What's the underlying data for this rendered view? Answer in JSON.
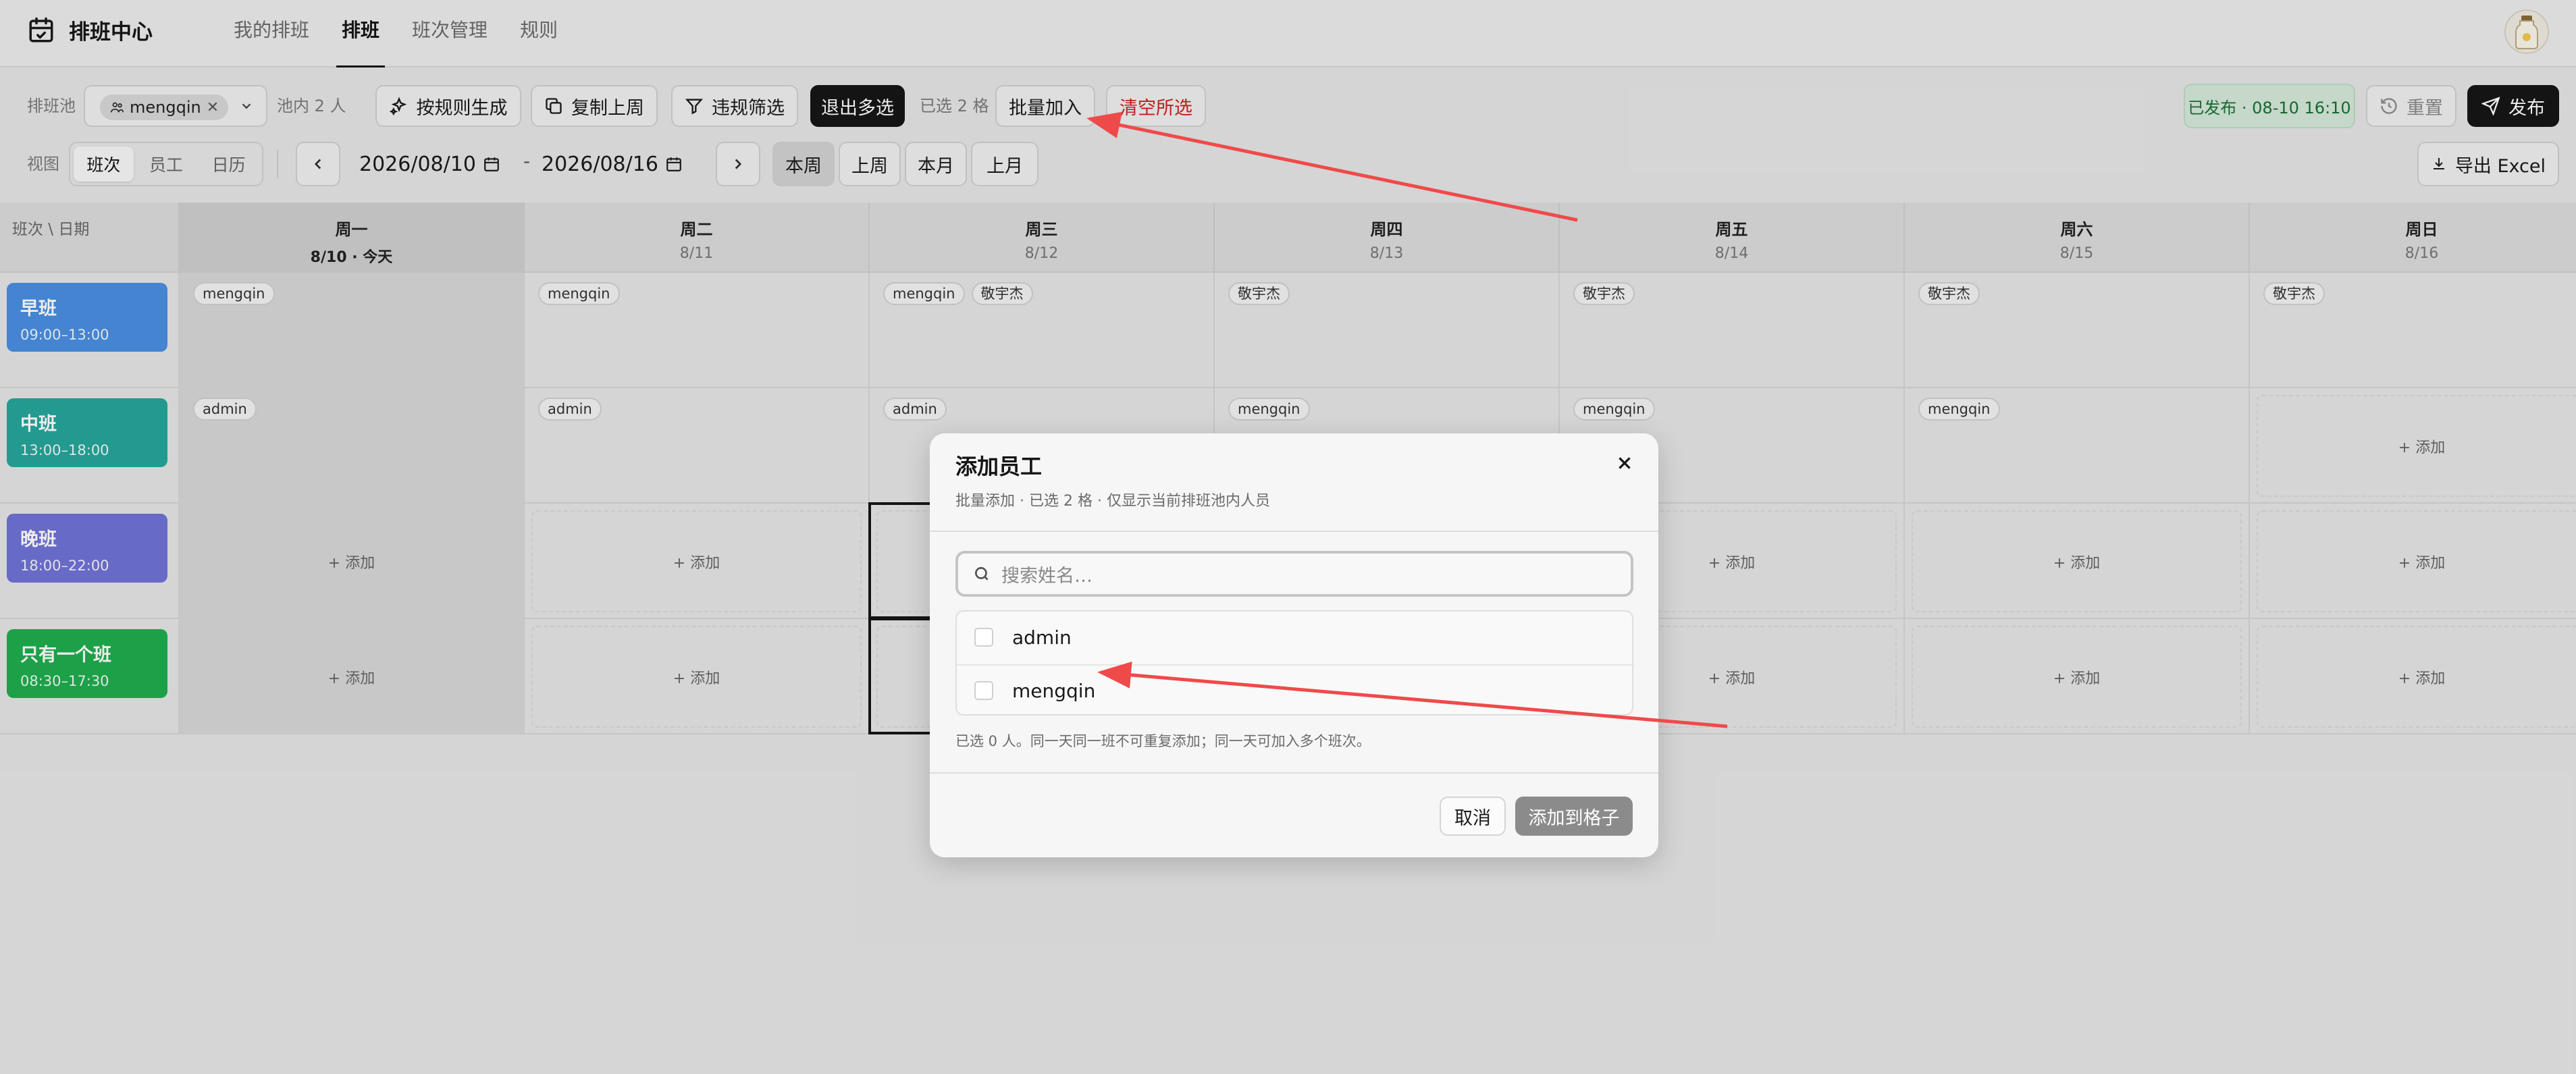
{
  "app": {
    "title": "排班中心"
  },
  "nav": {
    "tabs": [
      {
        "label": "我的排班"
      },
      {
        "label": "排班"
      },
      {
        "label": "班次管理"
      },
      {
        "label": "规则"
      }
    ]
  },
  "toolbar": {
    "pool_label": "排班池",
    "pool_chip": "mengqin",
    "pool_count": "池内 2 人",
    "generate": "按规则生成",
    "copy_last_week": "复制上周",
    "violation_filter": "违规筛选",
    "exit_multi": "退出多选",
    "selected_count": "已选 2 格",
    "batch_add": "批量加入",
    "clear_selection": "清空所选",
    "published_status": "已发布 · 08-10 16:10",
    "reset": "重置",
    "publish": "发布",
    "view_label": "视图",
    "view_options": [
      {
        "label": "班次"
      },
      {
        "label": "员工"
      },
      {
        "label": "日历"
      }
    ],
    "date_start": "2026/08/10",
    "date_sep": "-",
    "date_end": "2026/08/16",
    "ranges": [
      {
        "label": "本周"
      },
      {
        "label": "上周"
      },
      {
        "label": "本月"
      },
      {
        "label": "上月"
      }
    ],
    "export": "导出 Excel"
  },
  "grid": {
    "corner": "班次 \\ 日期",
    "days": [
      {
        "name": "周一",
        "date": "8/10 · 今天"
      },
      {
        "name": "周二",
        "date": "8/11"
      },
      {
        "name": "周三",
        "date": "8/12"
      },
      {
        "name": "周四",
        "date": "8/13"
      },
      {
        "name": "周五",
        "date": "8/14"
      },
      {
        "name": "周六",
        "date": "8/15"
      },
      {
        "name": "周日",
        "date": "8/16"
      }
    ],
    "add_label": "+ 添加",
    "shifts": [
      {
        "name": "早班",
        "time": "09:00–13:00",
        "color": "#4a8ee0",
        "cells": [
          [
            "mengqin"
          ],
          [
            "mengqin"
          ],
          [
            "mengqin",
            "敬宇杰"
          ],
          [
            "敬宇杰"
          ],
          [
            "敬宇杰"
          ],
          [
            "敬宇杰"
          ],
          [
            "敬宇杰"
          ]
        ]
      },
      {
        "name": "中班",
        "time": "13:00–18:00",
        "color": "#26a69a",
        "cells": [
          [
            "admin"
          ],
          [
            "admin"
          ],
          [
            "admin"
          ],
          [
            "mengqin"
          ],
          [
            "mengqin"
          ],
          [
            "mengqin"
          ],
          []
        ]
      },
      {
        "name": "晚班",
        "time": "18:00–22:00",
        "color": "#6f73d6",
        "cells": [
          [],
          [],
          [],
          [],
          [],
          [],
          []
        ]
      },
      {
        "name": "只有一个班",
        "time": "08:30–17:30",
        "color": "#1fae4e",
        "cells": [
          [],
          [],
          [],
          [],
          [],
          [],
          []
        ]
      }
    ]
  },
  "modal": {
    "title": "添加员工",
    "subtitle": "批量添加 · 已选 2 格 · 仅显示当前排班池内人员",
    "search_placeholder": "搜索姓名…",
    "employees": [
      {
        "name": "admin"
      },
      {
        "name": "mengqin"
      }
    ],
    "hint": "已选 0 人。同一天同一班不可重复添加；同一天可加入多个班次。",
    "cancel": "取消",
    "confirm": "添加到格子"
  },
  "colors": {
    "accent_dark": "#161616",
    "danger": "#d02020",
    "published_bg": "#d4e9d9",
    "arrow": "#ef4a4a"
  },
  "icons": [
    "calendar-check-icon",
    "users-icon",
    "close-icon",
    "chevron-down-icon",
    "sparkles-icon",
    "copy-icon",
    "filter-icon",
    "rotate-ccw-icon",
    "send-icon",
    "calendar-icon",
    "chevron-left-icon",
    "chevron-right-icon",
    "download-icon",
    "search-icon"
  ]
}
